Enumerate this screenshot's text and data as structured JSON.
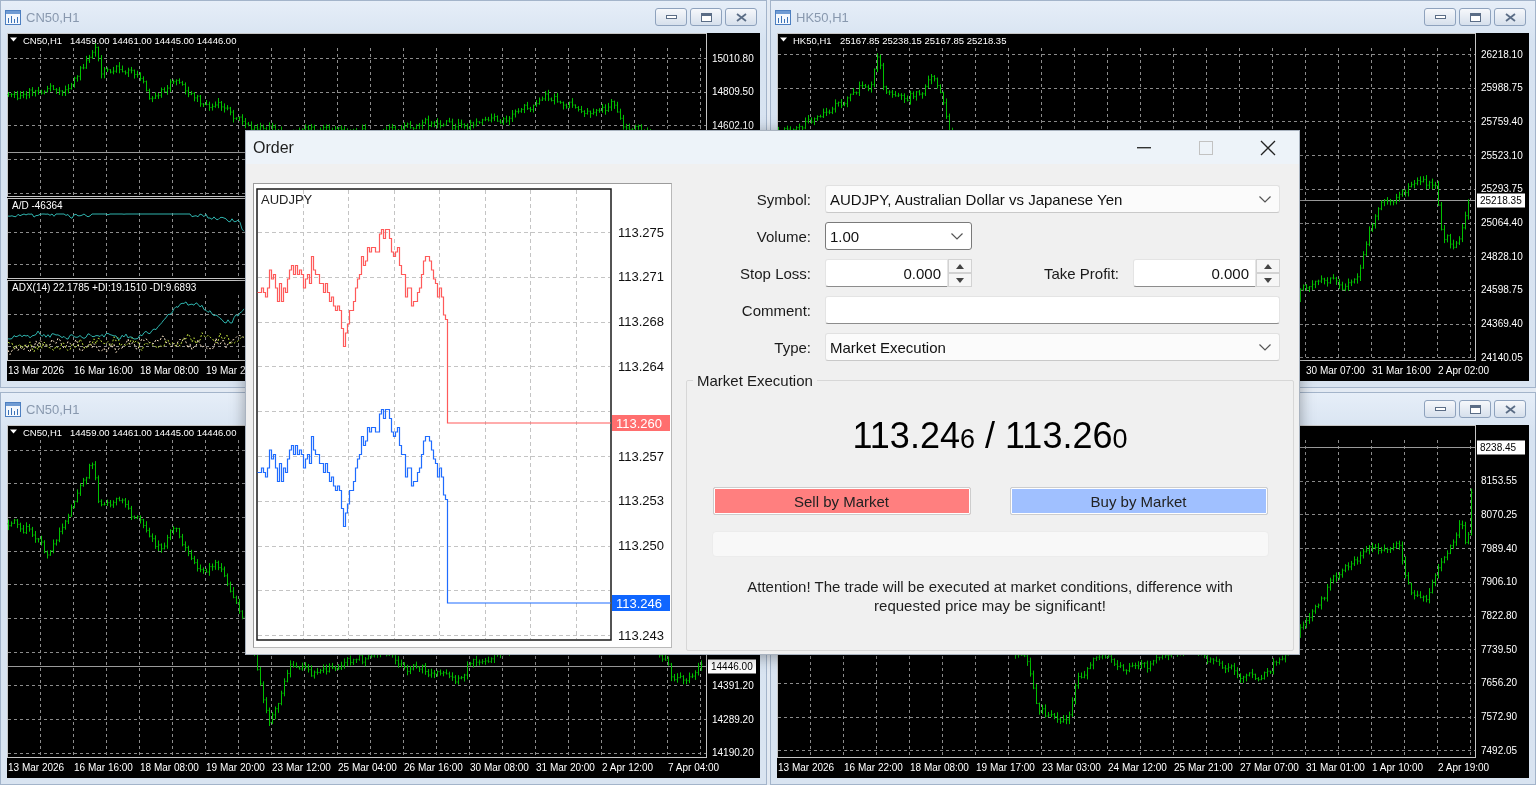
{
  "windows": [
    {
      "title": {
        "text": "CN50,H1",
        "active": false
      },
      "header": {
        "symbol": "CN50,H1",
        "ohlc": "14459.00 14461.00 14445.00 14446.00"
      },
      "panes": [
        {
          "kind": "bars",
          "price_labels": [
            "15010.80",
            "14809.50",
            "14602.10"
          ]
        },
        {
          "kind": "line",
          "label": "A/D -46364"
        },
        {
          "kind": "adx",
          "label": "ADX(14) 22.1785 +DI:19.1510 -DI:9.6893"
        }
      ],
      "time_labels": [
        "13 Mar 2026",
        "16 Mar 16:00",
        "18 Mar 08:00",
        "19 Mar 2"
      ]
    },
    {
      "title": {
        "text": "HK50,H1",
        "active": false
      },
      "header": {
        "symbol": "HK50,H1",
        "ohlc": "25167.85 25238.15 25167.85 25218.35"
      },
      "panes": [
        {
          "kind": "bars",
          "price_labels": [
            "26218.10",
            "25988.75",
            "25759.40",
            "25523.10",
            "25293.75",
            "25064.40",
            "24828.10",
            "24598.75",
            "24369.40",
            "24140.05"
          ],
          "current_price": "25218.35"
        }
      ],
      "time_labels": [
        "30 Mar 07:00",
        "31 Mar 16:00",
        "2 Apr 02:00"
      ]
    },
    {
      "title": {
        "text": "CN50,H1",
        "active": false
      },
      "header": {
        "symbol": "CN50,H1",
        "ohlc": "14459.00 14461.00 14445.00 14446.00"
      },
      "panes": [
        {
          "kind": "bars",
          "price_labels": [
            "14391.20",
            "14289.20",
            "14190.20"
          ],
          "current_price": "14446.00"
        }
      ],
      "time_labels": [
        "13 Mar 2026",
        "16 Mar 16:00",
        "18 Mar 08:00",
        "19 Mar 20:00",
        "23 Mar 12:00",
        "25 Mar 04:00",
        "26 Mar 16:00",
        "30 Mar 08:00",
        "31 Mar 20:00",
        "2 Apr 12:00",
        "7 Apr 04:00"
      ]
    },
    {
      "panes": [
        {
          "kind": "bars",
          "price_labels": [
            "8153.55",
            "8070.25",
            "7989.40",
            "7906.10",
            "7822.80",
            "7739.50",
            "7656.20",
            "7572.90",
            "7492.05"
          ],
          "current_price": "8238.45"
        }
      ],
      "time_labels": [
        "13 Mar 2026",
        "16 Mar 22:00",
        "18 Mar 08:00",
        "19 Mar 17:00",
        "23 Mar 03:00",
        "24 Mar 12:00",
        "25 Mar 21:00",
        "27 Mar 07:00",
        "31 Mar 01:00",
        "1 Apr 10:00",
        "2 Apr 19:00"
      ]
    }
  ],
  "order_dialog": {
    "title": "Order",
    "chart": {
      "symbol": "AUDJPY",
      "price_ticks": [
        "113.275",
        "113.271",
        "113.268",
        "113.264",
        "113.257",
        "113.253",
        "113.250",
        "113.243"
      ],
      "ask_tag": "113.260",
      "bid_tag": "113.246"
    },
    "form": [
      [
        {
          "label": "Symbol:",
          "kind": "select",
          "value": "AUDJPY, Australian Dollar vs Japanese Yen"
        }
      ],
      [
        {
          "label": "Volume:",
          "kind": "combo",
          "value": "1.00"
        }
      ],
      [
        {
          "label": "Stop Loss:",
          "kind": "spin",
          "value": "0.000"
        },
        {
          "label": "Take Profit:",
          "kind": "spin",
          "value": "0.000"
        }
      ],
      [
        {
          "label": "Comment:",
          "kind": "text"
        }
      ],
      [
        {
          "label": "Type:",
          "kind": "select",
          "value": "Market Execution"
        }
      ]
    ],
    "execution": {
      "title": "Market Execution",
      "quote": {
        "bid": "113.24",
        "bid_last": "6",
        "separator": "/",
        "ask": "113.26",
        "ask_last": "0"
      },
      "buttons": [
        {
          "label": "Sell by Market",
          "kind": "sell"
        },
        {
          "label": "Buy by Market",
          "kind": "buy"
        }
      ],
      "note": "Attention! The trade will be executed at market conditions, difference with requested price may be significant!"
    }
  }
}
